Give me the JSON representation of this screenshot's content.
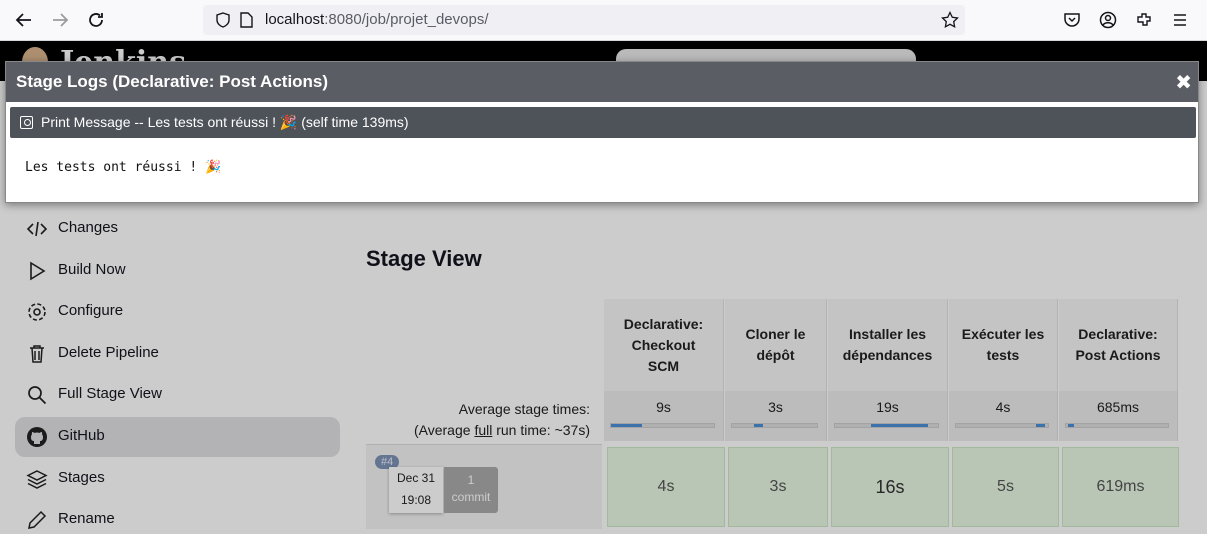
{
  "browser": {
    "url_host": "localhost",
    "url_rest": ":8080/job/projet_devops/"
  },
  "header": {
    "logo_text": "Jenkins"
  },
  "sidebar": {
    "items": [
      {
        "label": "Changes",
        "icon": "code-icon"
      },
      {
        "label": "Build Now",
        "icon": "play-icon"
      },
      {
        "label": "Configure",
        "icon": "gear-icon"
      },
      {
        "label": "Delete Pipeline",
        "icon": "trash-icon"
      },
      {
        "label": "Full Stage View",
        "icon": "search-icon"
      },
      {
        "label": "GitHub",
        "icon": "github-icon"
      },
      {
        "label": "Stages",
        "icon": "layers-icon"
      },
      {
        "label": "Rename",
        "icon": "pencil-icon"
      }
    ]
  },
  "stage_view": {
    "title": "Stage View",
    "avg_label_line1": "Average stage times:",
    "avg_label_line2_pre": "(Average ",
    "avg_label_line2_link": "full",
    "avg_label_line2_post": " run time: ~37s)",
    "stages": [
      {
        "name_lines": [
          "Declarative:",
          "Checkout",
          "SCM"
        ],
        "avg": "9s",
        "run": "4s",
        "avg_fill": 0.3
      },
      {
        "name_lines": [
          "Cloner le",
          "dépôt"
        ],
        "avg": "3s",
        "run": "3s",
        "avg_fill": 0.1
      },
      {
        "name_lines": [
          "Installer les",
          "dépendances"
        ],
        "avg": "19s",
        "run": "16s",
        "avg_fill": 0.55
      },
      {
        "name_lines": [
          "Exécuter les",
          "tests"
        ],
        "avg": "4s",
        "run": "5s",
        "avg_fill": 0.1
      },
      {
        "name_lines": [
          "Declarative:",
          "Post Actions"
        ],
        "avg": "685ms",
        "run": "619ms",
        "avg_fill": 0.02
      }
    ],
    "build": {
      "number": "#4",
      "date": "Dec 31",
      "time": "19:08",
      "commit_count": "1",
      "commit_label": "commit"
    }
  },
  "modal": {
    "title": "Stage Logs (Declarative: Post Actions)",
    "close_label": "✖",
    "step_text": "Print Message -- Les tests ont réussi ! 🎉 (self time 139ms)",
    "log_output": "Les tests ont réussi ! 🎉"
  },
  "colors": {
    "modal_title_bg": "#5a5d63",
    "success_cell": "#e8f8e3",
    "avg_bar_fill": "#4b8fd8"
  }
}
